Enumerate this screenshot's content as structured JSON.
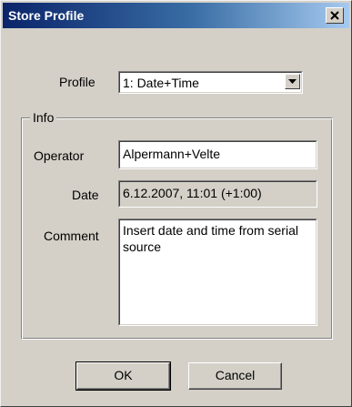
{
  "window": {
    "title": "Store Profile",
    "close_icon": "close-icon"
  },
  "profile": {
    "label": "Profile",
    "selected_value": "1: Date+Time",
    "dropdown_icon": "chevron-down-icon"
  },
  "info": {
    "group_label": "Info",
    "operator_label": "Operator",
    "operator_value": "Alpermann+Velte",
    "date_label": "Date",
    "date_value": "6.12.2007, 11:01 (+1:00)",
    "comment_label": "Comment",
    "comment_value": "Insert date and time from serial source"
  },
  "buttons": {
    "ok_label": "OK",
    "cancel_label": "Cancel"
  },
  "colors": {
    "title_bar_start": "#0a246a",
    "title_bar_end": "#a6caf0",
    "dialog_face": "#d4d0c8"
  }
}
